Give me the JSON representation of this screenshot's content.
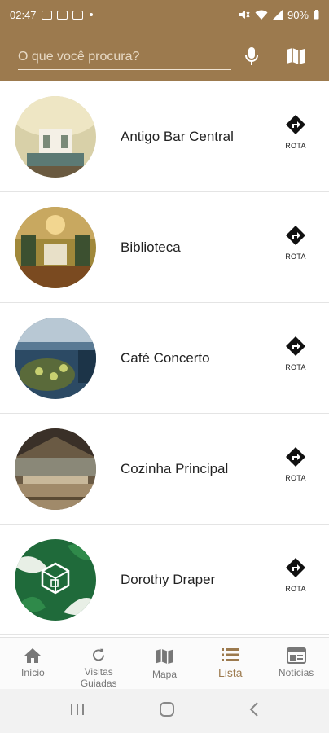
{
  "status_bar": {
    "time": "02:47",
    "battery": "90%"
  },
  "search": {
    "placeholder": "O que você procura?",
    "value": ""
  },
  "places": [
    {
      "title": "Antigo Bar Central",
      "route_label": "ROTA"
    },
    {
      "title": "Biblioteca",
      "route_label": "ROTA"
    },
    {
      "title": "Café Concerto",
      "route_label": "ROTA"
    },
    {
      "title": "Cozinha Principal",
      "route_label": "ROTA"
    },
    {
      "title": "Dorothy Draper",
      "route_label": "ROTA"
    }
  ],
  "bottom_nav": {
    "items": [
      {
        "label": "Início",
        "icon": "home-icon"
      },
      {
        "label": "Visitas Guiadas",
        "icon": "refresh-icon"
      },
      {
        "label": "Mapa",
        "icon": "map-icon"
      },
      {
        "label": "Lista",
        "icon": "list-icon",
        "active": true
      },
      {
        "label": "Notícias",
        "icon": "news-icon"
      }
    ]
  },
  "colors": {
    "brand": "#9c7a4e",
    "text": "#222222",
    "inactive": "#777777"
  }
}
